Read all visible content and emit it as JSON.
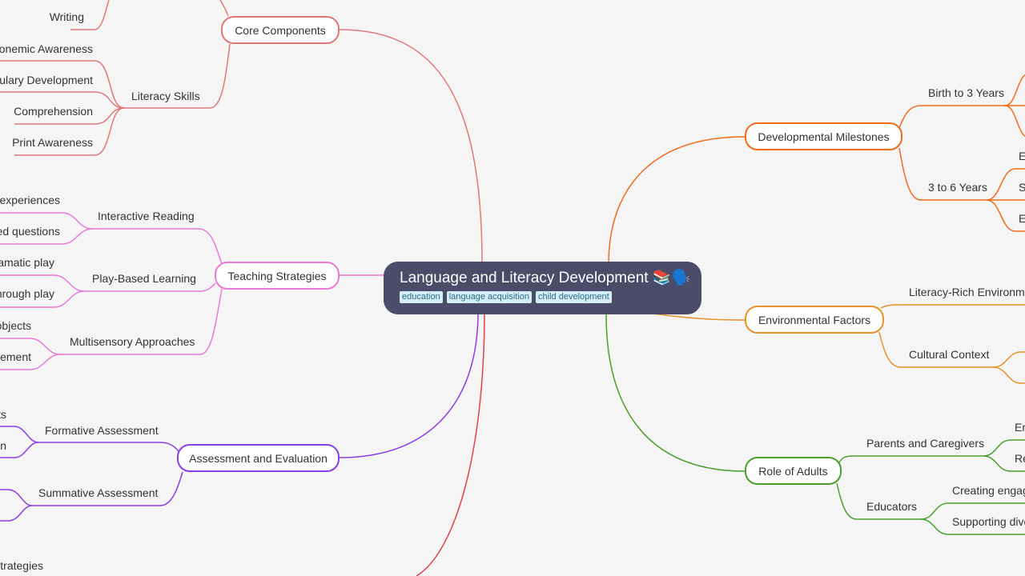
{
  "colors": {
    "background": "#f5f5f5",
    "root": "#4a4c6a",
    "core_components": "#e07878",
    "teaching_strategies": "#e87ad6",
    "assessment": "#8a3ee8",
    "hidden_branch": "#e0404c",
    "developmental": "#f36a1a",
    "environmental": "#e8922a",
    "role_of_adults": "#4aa02c"
  },
  "root": {
    "title": "Language and Literacy Development",
    "emoji": "📚🗣️",
    "tags": [
      "education",
      "language acquisition",
      "child development"
    ]
  },
  "left": {
    "core_components": {
      "label": "Core Components",
      "children": [
        {
          "label": "Writing"
        },
        {
          "label": "Literacy Skills",
          "children": [
            "Phonemic Awareness",
            "Vocabulary Development",
            "Comprehension",
            "Print Awareness"
          ]
        }
      ]
    },
    "teaching_strategies": {
      "label": "Teaching Strategies",
      "children": [
        {
          "label": "Interactive Reading",
          "children": [
            "experiences",
            "ed questions"
          ]
        },
        {
          "label": "Play-Based Learning",
          "children": [
            "amatic play",
            "hrough play"
          ]
        },
        {
          "label": "Multisensory Approaches",
          "children": [
            "objects",
            "ement"
          ]
        }
      ]
    },
    "assessment": {
      "label": "Assessment and Evaluation",
      "children": [
        {
          "label": "Formative Assessment",
          "children": [
            "ts",
            "n"
          ]
        },
        {
          "label": "Summative Assessment"
        }
      ]
    },
    "bottom_fragment": "strategies"
  },
  "right": {
    "developmental": {
      "label": "Developmental Milestones",
      "children": [
        {
          "label": "Birth to 3 Years"
        },
        {
          "label": "3 to 6 Years",
          "children": [
            "E",
            "S",
            "E"
          ]
        }
      ]
    },
    "environmental": {
      "label": "Environmental Factors",
      "children": [
        {
          "label": "Literacy-Rich Environme"
        },
        {
          "label": "Cultural Context"
        }
      ]
    },
    "role_of_adults": {
      "label": "Role of Adults",
      "children": [
        {
          "label": "Parents and Caregivers",
          "children": [
            "Em",
            "Re"
          ]
        },
        {
          "label": "Educators",
          "children": [
            "Creating engag",
            "Supporting dive"
          ]
        }
      ]
    }
  }
}
